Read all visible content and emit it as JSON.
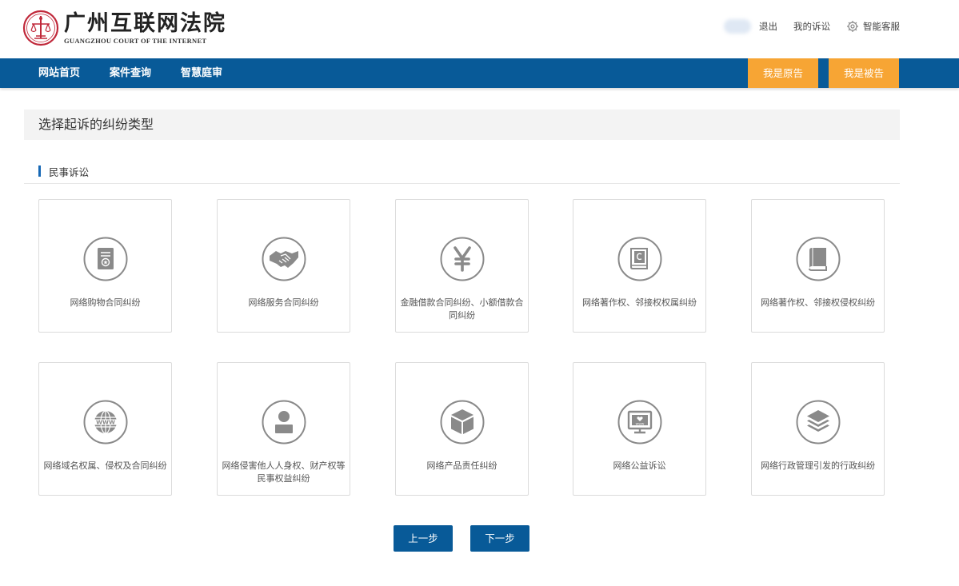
{
  "header": {
    "court_name": "广州互联网法院",
    "court_name_en": "GUANGZHOU COURT OF THE INTERNET",
    "logout": "退出",
    "my_cases": "我的诉讼",
    "service": "智能客服"
  },
  "nav": {
    "items": [
      "网站首页",
      "案件查询",
      "智慧庭审"
    ],
    "plaintiff": "我是原告",
    "defendant": "我是被告"
  },
  "main": {
    "title": "选择起诉的纠纷类型",
    "section": "民事诉讼",
    "cards": [
      {
        "label": "网络购物合同纠纷",
        "icon": "certificate-icon"
      },
      {
        "label": "网络服务合同纠纷",
        "icon": "handshake-icon"
      },
      {
        "label": "金融借款合同纠纷、小额借款合同纠纷",
        "icon": "yen-icon"
      },
      {
        "label": "网络著作权、邻接权权属纠纷",
        "icon": "copyright-book-icon"
      },
      {
        "label": "网络著作权、邻接权侵权纠纷",
        "icon": "book-icon"
      },
      {
        "label": "网络域名权属、侵权及合同纠纷",
        "icon": "www-globe-icon"
      },
      {
        "label": "网络侵害他人人身权、财产权等民事权益纠纷",
        "icon": "person-icon"
      },
      {
        "label": "网络产品责任纠纷",
        "icon": "box-icon"
      },
      {
        "label": "网络公益诉讼",
        "icon": "monitor-icon"
      },
      {
        "label": "网络行政管理引发的行政纠纷",
        "icon": "layers-icon"
      }
    ],
    "prev": "上一步",
    "next": "下一步"
  },
  "colors": {
    "nav_blue": "#085a98",
    "accent_orange": "#f7a534",
    "icon_gray": "#8a8a8a"
  }
}
